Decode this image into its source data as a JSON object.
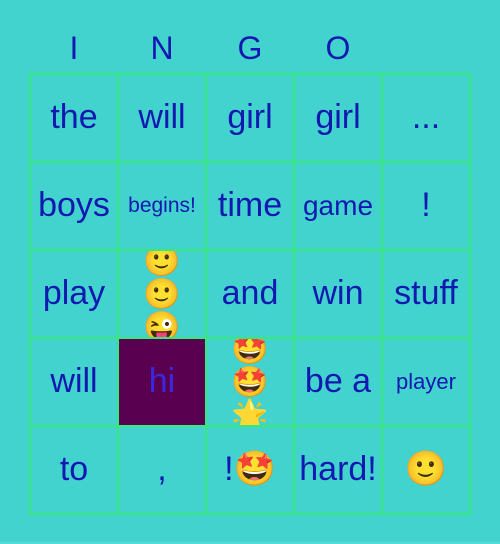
{
  "header": {
    "letters": [
      "I",
      "N",
      "G",
      "O",
      ""
    ]
  },
  "colors": {
    "background": "#43d3cf",
    "grid_line": "#38e87a",
    "text": "#1218b0",
    "marked_cell_bg": "#5a0050",
    "marked_cell_text": "#3a28e0"
  },
  "board": {
    "rows": [
      [
        {
          "text": "the",
          "marked": false
        },
        {
          "text": "will",
          "marked": false
        },
        {
          "text": "girl",
          "marked": false
        },
        {
          "text": "girl",
          "marked": false
        },
        {
          "text": "...",
          "marked": false
        }
      ],
      [
        {
          "text": "boys",
          "marked": false
        },
        {
          "text": "begins!",
          "marked": false
        },
        {
          "text": "time",
          "marked": false
        },
        {
          "text": "game",
          "marked": false
        },
        {
          "text": "!",
          "marked": false
        }
      ],
      [
        {
          "text": "play",
          "marked": false
        },
        {
          "text": "🙂🙂😜",
          "marked": false
        },
        {
          "text": "and",
          "marked": false
        },
        {
          "text": "win",
          "marked": false
        },
        {
          "text": "stuff",
          "marked": false
        }
      ],
      [
        {
          "text": "will",
          "marked": false
        },
        {
          "text": "hi",
          "marked": true
        },
        {
          "text": "🤩🤩🌟",
          "marked": false
        },
        {
          "text": "be a",
          "marked": false
        },
        {
          "text": "player",
          "marked": false
        }
      ],
      [
        {
          "text": "to",
          "marked": false
        },
        {
          "text": ",",
          "marked": false
        },
        {
          "text": "!🤩",
          "marked": false
        },
        {
          "text": "hard!",
          "marked": false
        },
        {
          "text": "🙂",
          "marked": false
        }
      ]
    ]
  }
}
